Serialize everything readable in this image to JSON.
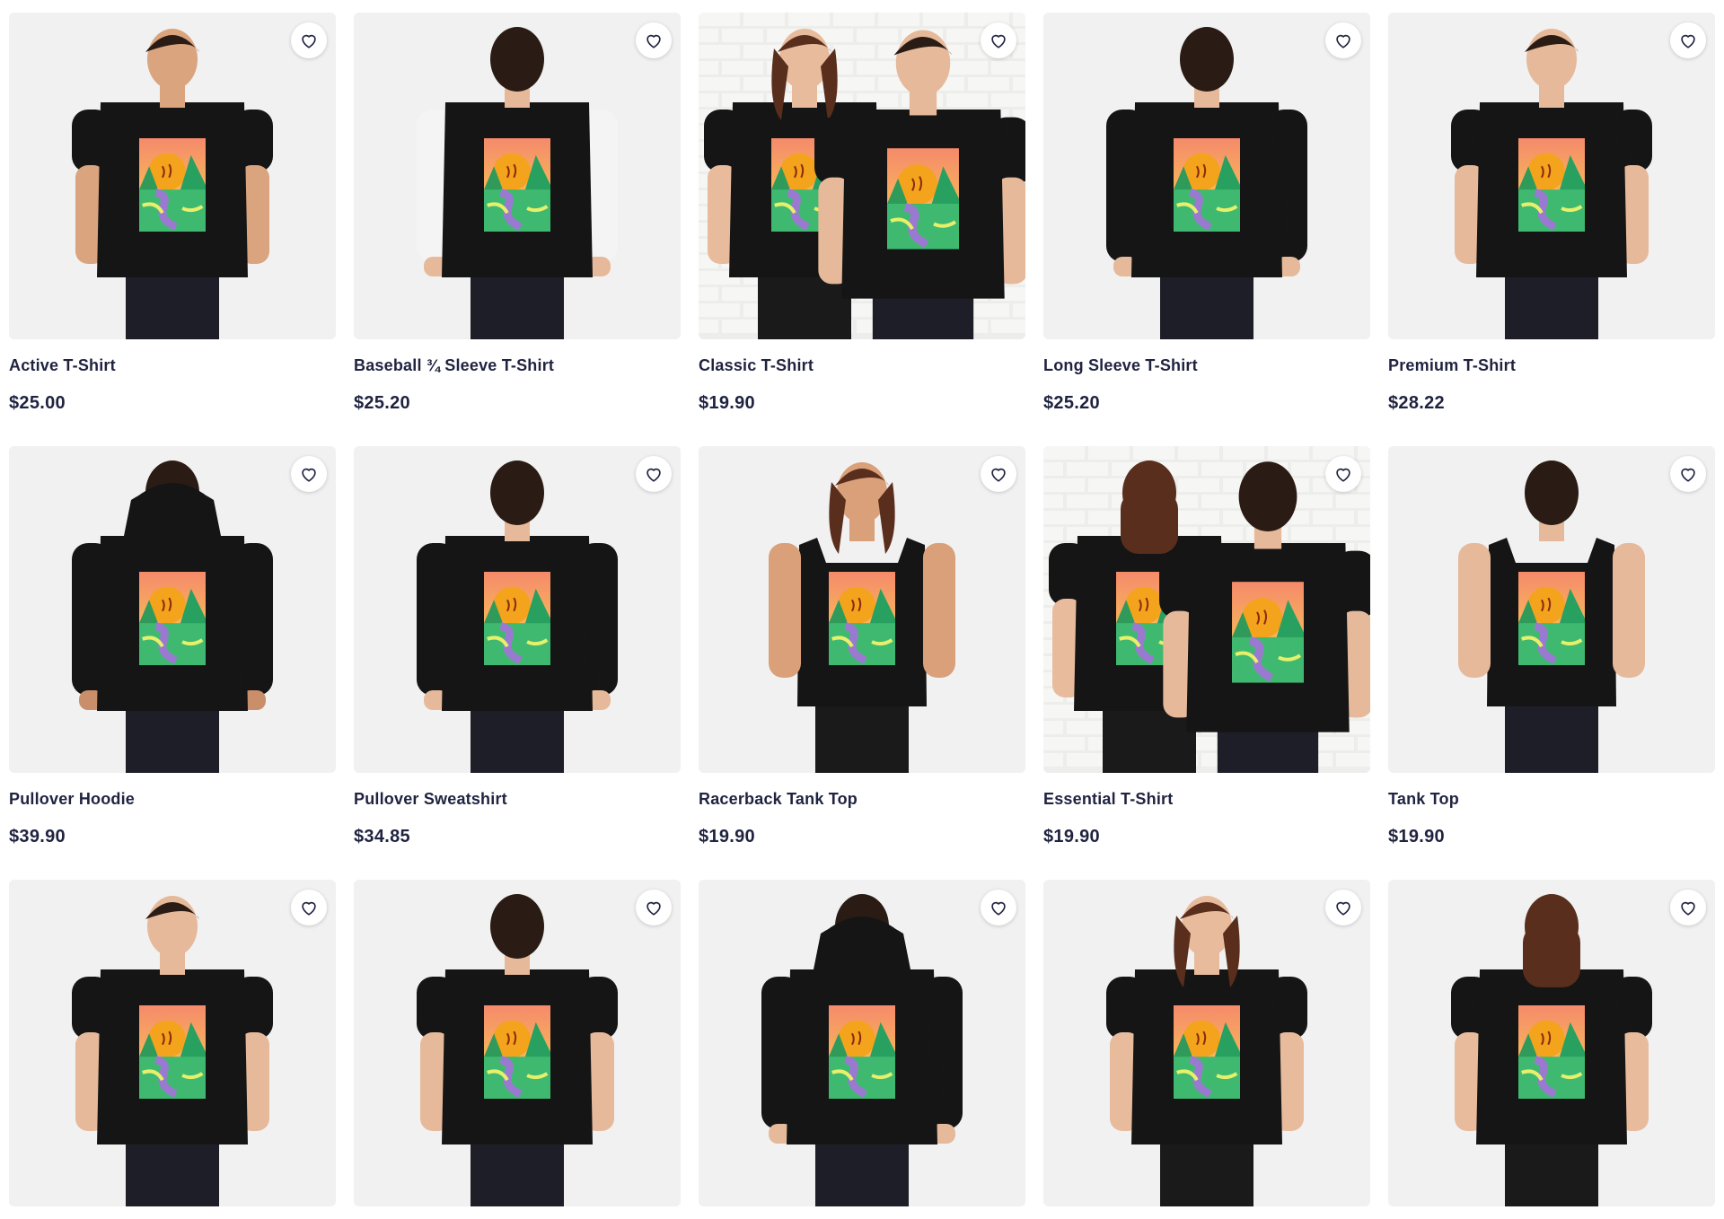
{
  "products": [
    {
      "title": "Active T-Shirt",
      "price": "$25.00",
      "garment": "tee",
      "view": "front",
      "person": "male-tan",
      "bg": "plain",
      "sleeve": "#151515"
    },
    {
      "title": "Baseball ¾ Sleeve T-Shirt",
      "price": "$25.20",
      "garment": "raglan",
      "view": "back",
      "person": "male-light",
      "bg": "plain",
      "sleeve": "#f4f4f4"
    },
    {
      "title": "Classic T-Shirt",
      "price": "$19.90",
      "garment": "tee",
      "view": "couple-front",
      "person": "couple",
      "bg": "brick",
      "sleeve": "#151515"
    },
    {
      "title": "Long Sleeve T-Shirt",
      "price": "$25.20",
      "garment": "longsleeve",
      "view": "back",
      "person": "male-light",
      "bg": "plain",
      "sleeve": "#151515"
    },
    {
      "title": "Premium T-Shirt",
      "price": "$28.22",
      "garment": "tee",
      "view": "front",
      "person": "male-light",
      "bg": "plain",
      "sleeve": "#151515"
    },
    {
      "title": "Pullover Hoodie",
      "price": "$39.90",
      "garment": "hoodie",
      "view": "back",
      "person": "male-dark",
      "bg": "plain",
      "sleeve": "#151515"
    },
    {
      "title": "Pullover Sweatshirt",
      "price": "$34.85",
      "garment": "longsleeve",
      "view": "back",
      "person": "male-light",
      "bg": "plain",
      "sleeve": "#151515"
    },
    {
      "title": "Racerback Tank Top",
      "price": "$19.90",
      "garment": "tank",
      "view": "front",
      "person": "female-tan",
      "bg": "plain",
      "sleeve": "#151515"
    },
    {
      "title": "Essential T-Shirt",
      "price": "$19.90",
      "garment": "tee",
      "view": "couple-back",
      "person": "couple",
      "bg": "brick",
      "sleeve": "#2a2a2a"
    },
    {
      "title": "Tank Top",
      "price": "$19.90",
      "garment": "tank",
      "view": "back",
      "person": "male-light",
      "bg": "plain",
      "sleeve": "#151515"
    },
    {
      "title": "",
      "price": "",
      "garment": "tee",
      "view": "front",
      "person": "male-light",
      "bg": "plain",
      "sleeve": "#1f1f1f"
    },
    {
      "title": "",
      "price": "",
      "garment": "tee",
      "view": "back",
      "person": "male-light",
      "bg": "plain",
      "sleeve": "#151515"
    },
    {
      "title": "",
      "price": "",
      "garment": "hoodie",
      "view": "back",
      "person": "male-light",
      "bg": "plain",
      "sleeve": "#151515"
    },
    {
      "title": "",
      "price": "",
      "garment": "tee",
      "view": "front",
      "person": "female-light",
      "bg": "plain",
      "sleeve": "#151515"
    },
    {
      "title": "",
      "price": "",
      "garment": "tee",
      "view": "back",
      "person": "female-light",
      "bg": "plain",
      "sleeve": "#151515"
    }
  ],
  "icons": {
    "favorite": "heart-outline-icon"
  },
  "colors": {
    "text": "#1f2340",
    "thumb_bg": "#f1f1f1",
    "shirt": "#151515"
  }
}
